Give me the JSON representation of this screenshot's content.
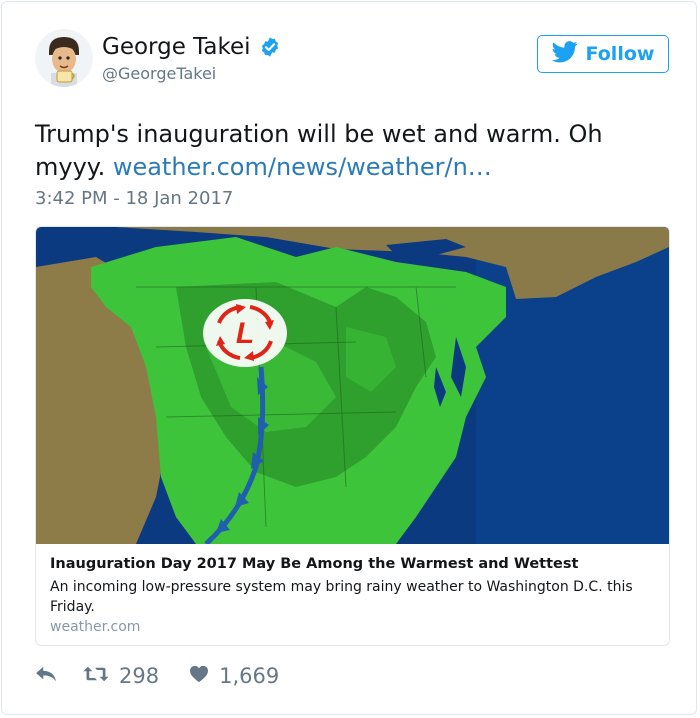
{
  "author": {
    "name": "George Takei",
    "handle": "@GeorgeTakei",
    "verified": true,
    "avatar_icon": "avatar-illustration"
  },
  "follow_button": {
    "label": "Follow",
    "icon": "twitter-bird-icon"
  },
  "tweet": {
    "text": "Trump's inauguration will be wet and warm. Oh myyy. ",
    "link": "weather.com/news/weather/n…",
    "timestamp": "3:42 PM - 18 Jan 2017"
  },
  "card": {
    "title": "Inauguration Day 2017 May Be Among the Warmest and Wettest",
    "description": "An incoming low-pressure system may bring rainy weather to Washington D.C. this Friday.",
    "domain": "weather.com",
    "map_marker": "L"
  },
  "actions": {
    "reply_icon": "reply-icon",
    "retweet_icon": "retweet-icon",
    "retweets": "298",
    "like_icon": "heart-icon",
    "likes": "1,669"
  },
  "colors": {
    "accent": "#1da1f2",
    "link": "#2b7bb9",
    "ocean": "#0c3f86",
    "land_green": "#3ec43b",
    "rain_green": "#2f9f2e",
    "front_blue": "#1f5fae",
    "low_red": "#e02418"
  }
}
